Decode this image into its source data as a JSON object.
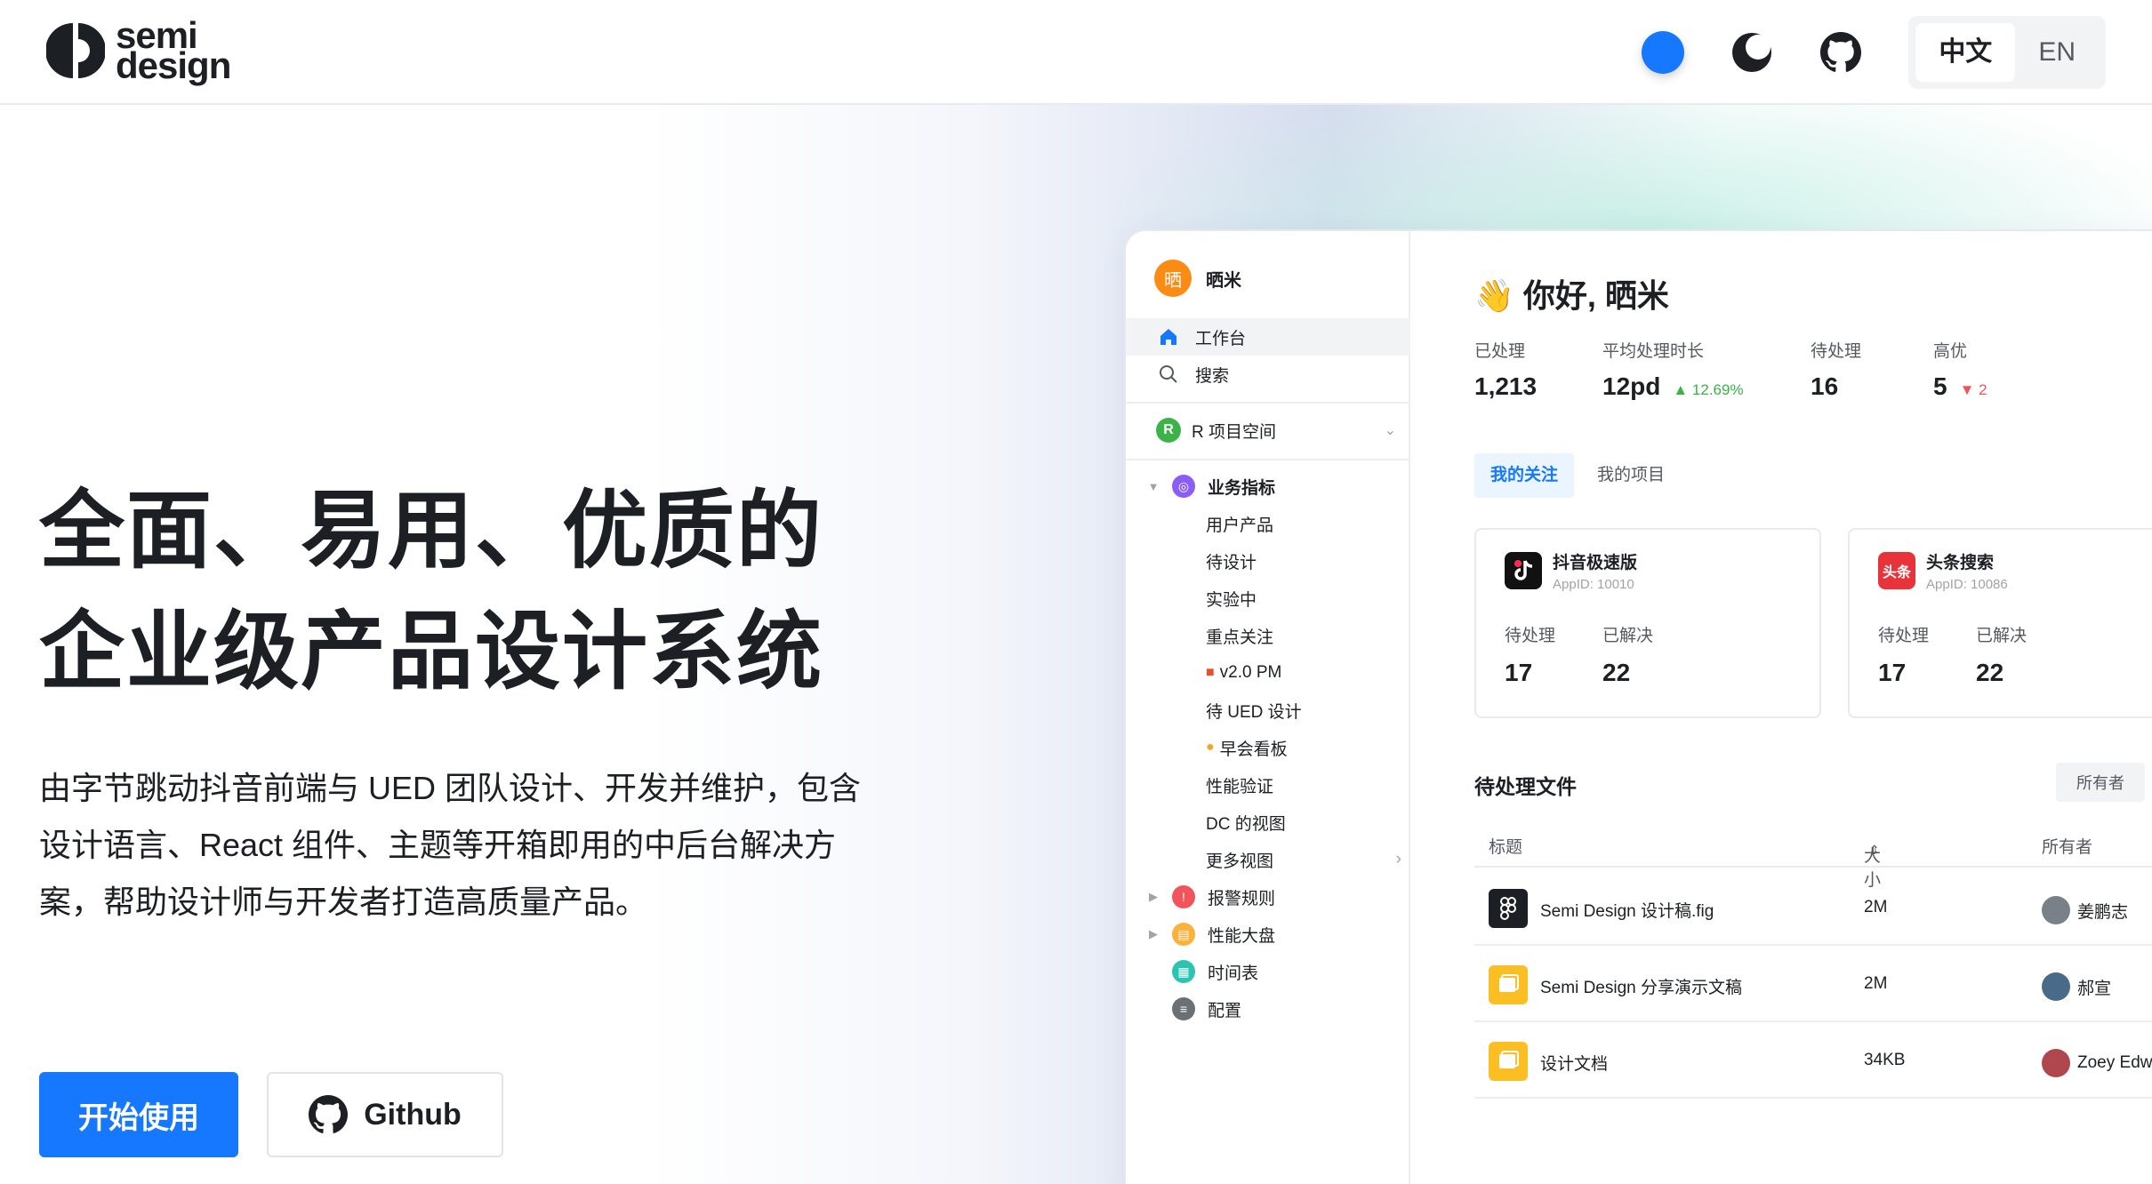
{
  "header": {
    "logo_line1": "semi",
    "logo_line2": "design",
    "lang_zh": "中文",
    "lang_en": "EN",
    "accent": "#1677ff"
  },
  "hero": {
    "title_line1": "全面、易用、优质的",
    "title_line2": "企业级产品设计系统",
    "desc_line1": "由字节跳动抖音前端与 UED 团队设计、开发并维护，包含",
    "desc_line2": "设计语言、React 组件、主题等开箱即用的中后台解决方",
    "desc_line3": "案，帮助设计师与开发者打造高质量产品。",
    "start_label": "开始使用",
    "github_label": "Github"
  },
  "preview": {
    "sidebar": {
      "user_initial": "晒",
      "user_name": "晒米",
      "nav_home": "工作台",
      "nav_search": "搜索",
      "project_initial": "R",
      "project_name": "R 项目空间",
      "tree_metrics": "业务指标",
      "subs": [
        "用户产品",
        "待设计",
        "实验中",
        "重点关注",
        "v2.0 PM",
        "待 UED 设计",
        "早会看板",
        "性能验证",
        "DC 的视图",
        "更多视图"
      ],
      "tree_alerts": "报警规则",
      "tree_perf": "性能大盘",
      "tree_schedule": "时间表",
      "tree_config": "配置"
    },
    "main": {
      "greeting": "你好, 晒米",
      "greeting_emoji": "👋",
      "stats": [
        {
          "label": "已处理",
          "value": "1,213",
          "trend": ""
        },
        {
          "label": "平均处理时长",
          "value": "12pd",
          "trend": "▲ 12.69%"
        },
        {
          "label": "待处理",
          "value": "16",
          "trend": ""
        },
        {
          "label": "高优",
          "value": "5",
          "trend": "▼ 2"
        }
      ],
      "tab_follow": "我的关注",
      "tab_projects": "我的项目",
      "cards": [
        {
          "name": "抖音极速版",
          "appid": "AppID: 10010",
          "pending_label": "待处理",
          "pending": "17",
          "resolved_label": "已解决",
          "resolved": "22"
        },
        {
          "name": "头条搜索",
          "appid": "AppID: 10086",
          "icon_text": "头条",
          "pending_label": "待处理",
          "pending": "17",
          "resolved_label": "已解决",
          "resolved": "22"
        }
      ],
      "files_title": "待处理文件",
      "owner_filter": "所有者",
      "col_title": "标题",
      "col_size": "大小",
      "col_owner": "所有者",
      "files": [
        {
          "name": "Semi Design 设计稿.fig",
          "size": "2M",
          "owner": "姜鹏志"
        },
        {
          "name": "Semi Design 分享演示文稿",
          "size": "2M",
          "owner": "郝宣"
        },
        {
          "name": "设计文档",
          "size": "34KB",
          "owner": "Zoey Edw"
        }
      ]
    }
  }
}
